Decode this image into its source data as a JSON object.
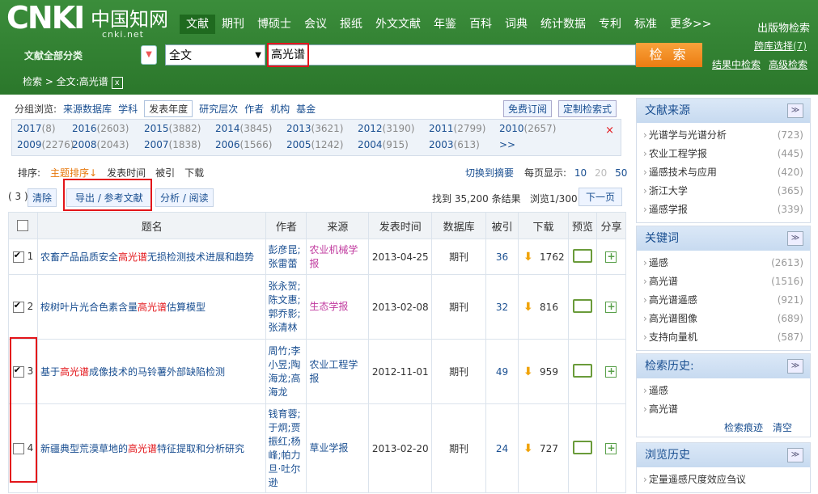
{
  "brand": {
    "logo_text": "CNKI",
    "logo_zh": "中国知网",
    "logo_url": "cnki.net"
  },
  "topnav": [
    "文献",
    "期刊",
    "博硕士",
    "会议",
    "报纸",
    "外文文献",
    "年鉴",
    "百科",
    "词典",
    "统计数据",
    "专利",
    "标准",
    "更多>>"
  ],
  "header": {
    "pub_search": "出版物检索",
    "cross_db": "跨库选择",
    "cross_db_count": "(7)",
    "all_categories": "文献全部分类",
    "in_results": "结果中检索",
    "advanced": "高级检索"
  },
  "search": {
    "field": "全文",
    "query": "高光谱",
    "button": "检 索"
  },
  "breadcrumb": {
    "text": "检索 > 全文:高光谱",
    "close": "x"
  },
  "group": {
    "label": "分组浏览:",
    "items": [
      "来源数据库",
      "学科",
      "发表年度",
      "研究层次",
      "作者",
      "机构",
      "基金"
    ],
    "free_sub": "免费订阅",
    "custom": "定制检索式"
  },
  "years": [
    {
      "y": "2017",
      "c": "(8)"
    },
    {
      "y": "2016",
      "c": "(2603)"
    },
    {
      "y": "2015",
      "c": "(3882)"
    },
    {
      "y": "2014",
      "c": "(3845)"
    },
    {
      "y": "2013",
      "c": "(3621)"
    },
    {
      "y": "2012",
      "c": "(3190)"
    },
    {
      "y": "2011",
      "c": "(2799)"
    },
    {
      "y": "2010",
      "c": "(2657)"
    },
    {
      "y": "2009",
      "c": "(2276)"
    },
    {
      "y": "2008",
      "c": "(2043)"
    },
    {
      "y": "2007",
      "c": "(1838)"
    },
    {
      "y": "2006",
      "c": "(1566)"
    },
    {
      "y": "2005",
      "c": "(1242)"
    },
    {
      "y": "2004",
      "c": "(915)"
    },
    {
      "y": "2003",
      "c": "(613)"
    },
    {
      "y": ">>",
      "c": ""
    }
  ],
  "years_close": "×",
  "sort": {
    "label": "排序:",
    "subject": "主题排序",
    "subject_arrow": "↓",
    "date": "发表时间",
    "cited": "被引",
    "downloads": "下载",
    "switch_abstract": "切换到摘要",
    "per_page_label": "每页显示:",
    "per_page": [
      "10",
      "20",
      "50"
    ]
  },
  "actions": {
    "count": "( 3 )",
    "clear": "清除",
    "export": "导出 / 参考文献",
    "analyze": "分析 / 阅读",
    "found": "找到 35,200 条结果",
    "browse": "浏览1/300",
    "next": "下一页"
  },
  "table": {
    "headers": [
      "题名",
      "作者",
      "来源",
      "发表时间",
      "数据库",
      "被引",
      "下载",
      "预览",
      "分享"
    ],
    "rows": [
      {
        "n": "1",
        "checked": true,
        "title_pre": "农畜产品品质安全",
        "title_hl": "高光谱",
        "title_post": "无损检测技术进展和趋势",
        "authors": "彭彦昆;\n张雷蕾",
        "source": "农业机械学报",
        "src_color": "pink",
        "date": "2013-04-25",
        "db": "期刊",
        "cited": "36",
        "downloads": "1762"
      },
      {
        "n": "2",
        "checked": true,
        "title_pre": "桉树叶片光合色素含量",
        "title_hl": "高光谱",
        "title_post": "估算模型",
        "authors": "张永贺;\n陈文惠;\n郭乔影;\n张清林",
        "source": "生态学报",
        "src_color": "pink",
        "date": "2013-02-08",
        "db": "期刊",
        "cited": "32",
        "downloads": "816"
      },
      {
        "n": "3",
        "checked": true,
        "title_pre": "基于",
        "title_hl": "高光谱",
        "title_post": "成像技术的马铃薯外部缺陷检测",
        "authors": "周竹;李\n小昱;陶\n海龙;高\n海龙",
        "source": "农业工程学\n报",
        "src_color": "blue",
        "date": "2012-11-01",
        "db": "期刊",
        "cited": "49",
        "downloads": "959"
      },
      {
        "n": "4",
        "checked": false,
        "title_pre": "新疆典型荒漠草地的",
        "title_hl": "高光谱",
        "title_post": "特征提取和分析研究",
        "authors": "钱育蓉;\n于炯;贾\n振红;杨\n峰;帕力\n旦·吐尔\n逊",
        "source": "草业学报",
        "src_color": "blue",
        "date": "2013-02-20",
        "db": "期刊",
        "cited": "24",
        "downloads": "727"
      }
    ]
  },
  "sidebar": {
    "source": {
      "title": "文献来源",
      "items": [
        {
          "t": "光谱学与光谱分析",
          "n": "(723)"
        },
        {
          "t": "农业工程学报",
          "n": "(445)"
        },
        {
          "t": "遥感技术与应用",
          "n": "(420)"
        },
        {
          "t": "浙江大学",
          "n": "(365)"
        },
        {
          "t": "遥感学报",
          "n": "(339)"
        }
      ]
    },
    "keywords": {
      "title": "关键词",
      "items": [
        {
          "t": "遥感",
          "n": "(2613)"
        },
        {
          "t": "高光谱",
          "n": "(1516)"
        },
        {
          "t": "高光谱遥感",
          "n": "(921)"
        },
        {
          "t": "高光谱图像",
          "n": "(689)"
        },
        {
          "t": "支持向量机",
          "n": "(587)"
        }
      ]
    },
    "history": {
      "title": "检索历史:",
      "items": [
        "遥感",
        "高光谱"
      ],
      "trace": "检索痕迹",
      "clear": "清空"
    },
    "browse": {
      "title": "浏览历史",
      "items": [
        "定量遥感尺度效应刍议"
      ]
    },
    "toggle_icon": "≫"
  }
}
